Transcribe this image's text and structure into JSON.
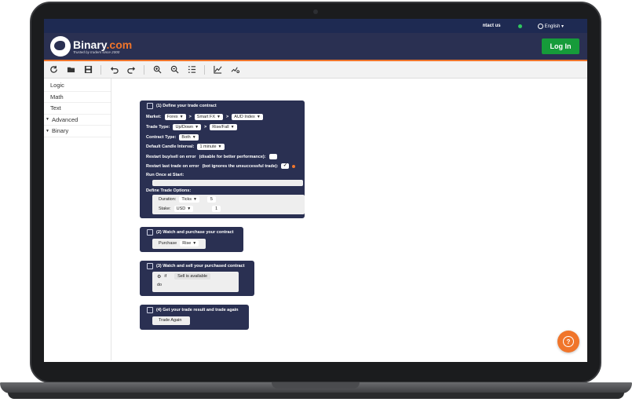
{
  "topbar": {
    "contact": "ntact us",
    "language": "English ▾",
    "status_color": "#2fc85e"
  },
  "header": {
    "brand_name": "Binary",
    "brand_suffix": ".com",
    "tagline": "Trusted by traders since 2000",
    "login": "Log In"
  },
  "toolbar": {
    "icons": [
      "reset-icon",
      "open-folder-icon",
      "save-icon",
      "undo-icon",
      "redo-icon",
      "zoom-in-icon",
      "zoom-out-icon",
      "rearrange-icon",
      "chart-icon",
      "tradingview-icon"
    ]
  },
  "sidebar": {
    "items": [
      {
        "label": "Logic"
      },
      {
        "label": "Math"
      },
      {
        "label": "Text"
      },
      {
        "label": "Advanced"
      },
      {
        "label": "Binary"
      }
    ],
    "caret": "▼"
  },
  "block1": {
    "title": "(1) Define your trade contract",
    "market_label": "Market:",
    "market": "Forex",
    "submarket": "Smart FX",
    "symbol": "AUD Index",
    "sep": ">",
    "trade_type_label": "Trade Type:",
    "trade_type": "Up/Down",
    "trade_subtype": "Rise/Fall",
    "contract_type_label": "Contract Type:",
    "contract_type": "Both",
    "candle_label": "Default Candle Interval:",
    "candle": "1 minute",
    "restart_buy_label": "Restart buy/sell on error",
    "restart_buy_hint": "(disable for better performance):",
    "restart_last_label": "Restart last trade on error",
    "restart_last_hint": "(bot ignores the unsuccessful trade):",
    "restart_last_check": "✓",
    "run_once_label": "Run Once at Start:",
    "options_label": "Define Trade Options:",
    "duration_label": "Duration:",
    "duration_unit": "Ticks",
    "duration_value": "5",
    "stake_label": "Stake:",
    "currency": "USD",
    "stake_value": "1"
  },
  "block2": {
    "title": "(2) Watch and purchase your contract",
    "purchase_label": "Purchase",
    "purchase_value": "Rise"
  },
  "block3": {
    "title": "(3) Watch and sell your purchased contract",
    "if_label": "if",
    "condition": "Sell is available",
    "do_label": "do"
  },
  "block4": {
    "title": "(4) Get your trade result and trade again",
    "action": "Trade Again"
  },
  "dropdown_arrow": "▼",
  "help": {
    "symbol": "?"
  }
}
